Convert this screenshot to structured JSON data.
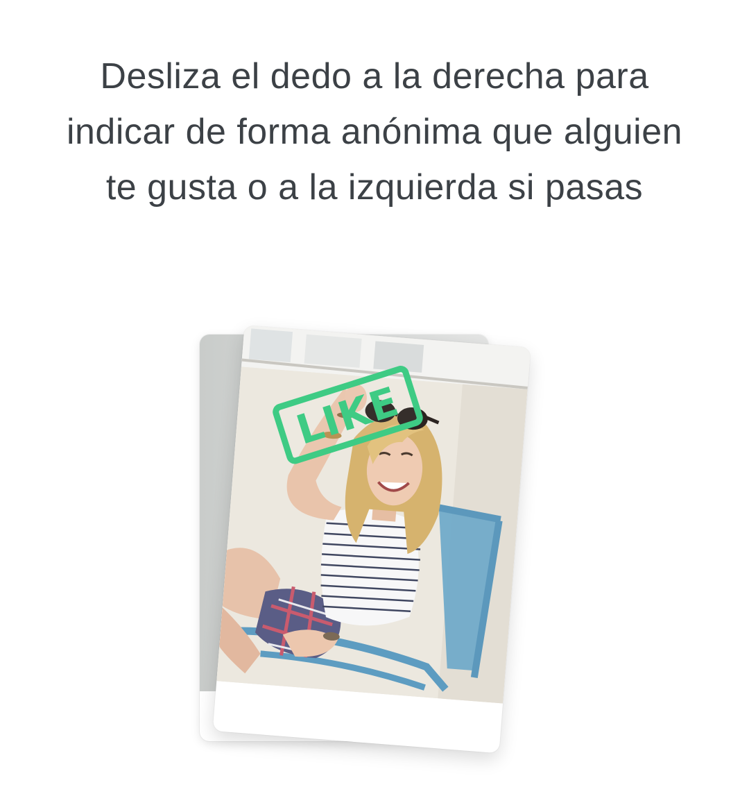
{
  "onboarding": {
    "headline": "Desliza el dedo a la derecha para indicar de forma anónima que alguien te gusta o a la izquierda si pasas"
  },
  "card": {
    "stamp_label": "LIKE",
    "stamp_color": "#3ecb84",
    "photo_description_icon": "profile-photo"
  },
  "colors": {
    "text": "#3c4146",
    "background": "#ffffff"
  }
}
